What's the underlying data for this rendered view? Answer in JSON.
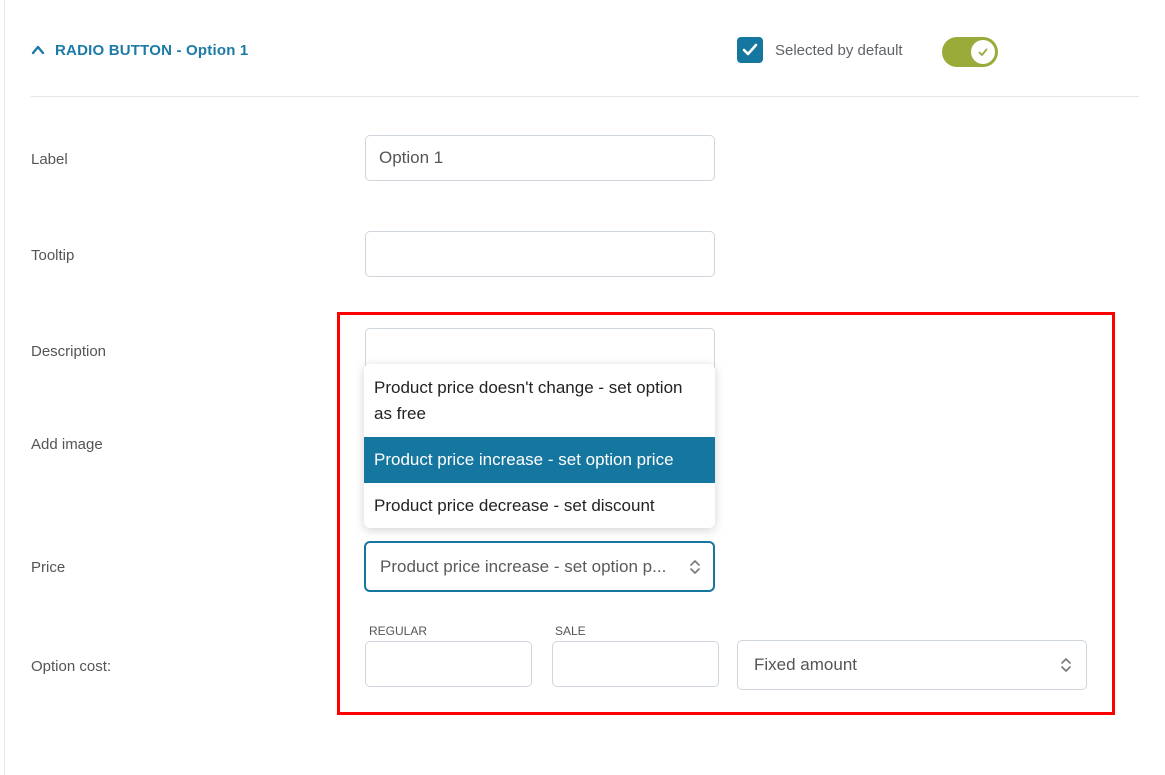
{
  "header": {
    "title": "RADIO BUTTON - Option 1",
    "selected_default_label": "Selected by default",
    "selected_default_checked": true,
    "toggle_on": true
  },
  "fields": {
    "label": {
      "label": "Label",
      "value": "Option 1"
    },
    "tooltip": {
      "label": "Tooltip",
      "value": ""
    },
    "description": {
      "label": "Description",
      "value": ""
    },
    "add_image": {
      "label": "Add image"
    },
    "price": {
      "label": "Price",
      "selected": "Product price increase - set option p...",
      "options": [
        "Product price doesn't change - set option as free",
        "Product price increase - set option price",
        "Product price decrease - set discount"
      ],
      "active_index": 1
    },
    "option_cost": {
      "label": "Option cost:",
      "regular_label": "REGULAR",
      "sale_label": "SALE",
      "regular_value": "",
      "sale_value": "",
      "type_selected": "Fixed amount"
    }
  },
  "colors": {
    "accent": "#1577a0",
    "toggle": "#9aab3a",
    "highlight": "#ff0000"
  }
}
